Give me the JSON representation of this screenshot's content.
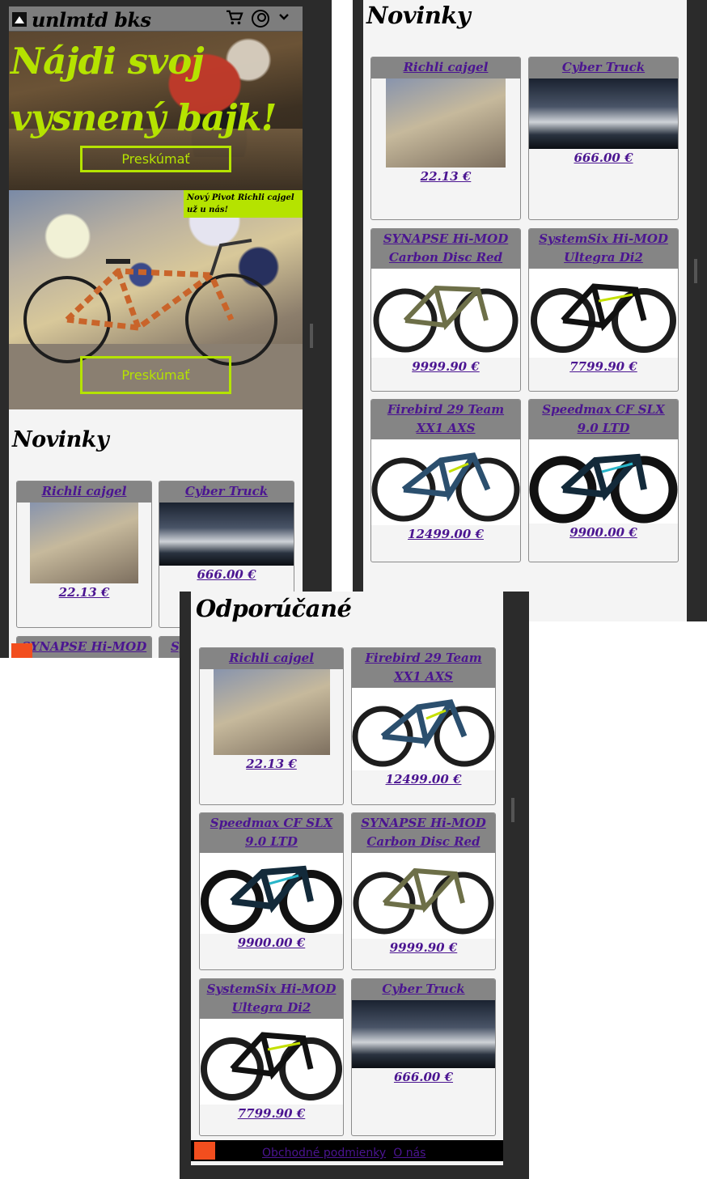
{
  "header": {
    "brand": "unlmtd bks",
    "icons": [
      "cart-icon",
      "account-icon",
      "chevron-down-icon"
    ]
  },
  "hero": {
    "title": "Nájdi svoj vysnený bajk!",
    "cta": "Preskúmať"
  },
  "promo": {
    "badge": "Nový Pivot Richli cajgel už u nás!",
    "cta": "Preskúmať"
  },
  "novinky": {
    "title": "Novinky",
    "products": [
      {
        "name": "Richli cajgel",
        "price": "22.13 €"
      },
      {
        "name": "Cyber Truck",
        "price": "666.00 €"
      },
      {
        "name": "SYNAPSE Hi-MOD Carbon Disc Red",
        "price": "9999.90 €"
      },
      {
        "name": "SystemSix Hi-MOD Ultegra Di2",
        "price": "7799.90 €"
      },
      {
        "name": "Firebird 29 Team XX1 AXS",
        "price": "12499.00 €"
      },
      {
        "name": "Speedmax CF SLX 9.0 LTD",
        "price": "9900.00 €"
      }
    ]
  },
  "odporucane": {
    "title": "Odporúčané",
    "products": [
      {
        "name": "Richli cajgel",
        "price": "22.13 €"
      },
      {
        "name": "Firebird 29 Team XX1 AXS",
        "price": "12499.00 €"
      },
      {
        "name": "Speedmax CF SLX 9.0 LTD",
        "price": "9900.00 €"
      },
      {
        "name": "SYNAPSE Hi-MOD Carbon Disc Red",
        "price": "9999.90 €"
      },
      {
        "name": "SystemSix Hi-MOD Ultegra Di2",
        "price": "7799.90 €"
      },
      {
        "name": "Cyber Truck",
        "price": "666.00 €"
      }
    ]
  },
  "footer": {
    "links": [
      "Obchodné podmienky",
      "O nás"
    ]
  },
  "partial_text": {
    "name_1": "SYNAPSE Hi-MOD",
    "name_2": "Sy"
  },
  "colors": {
    "accent": "#b5e300",
    "link": "#4b1591",
    "card_head": "#858585"
  }
}
